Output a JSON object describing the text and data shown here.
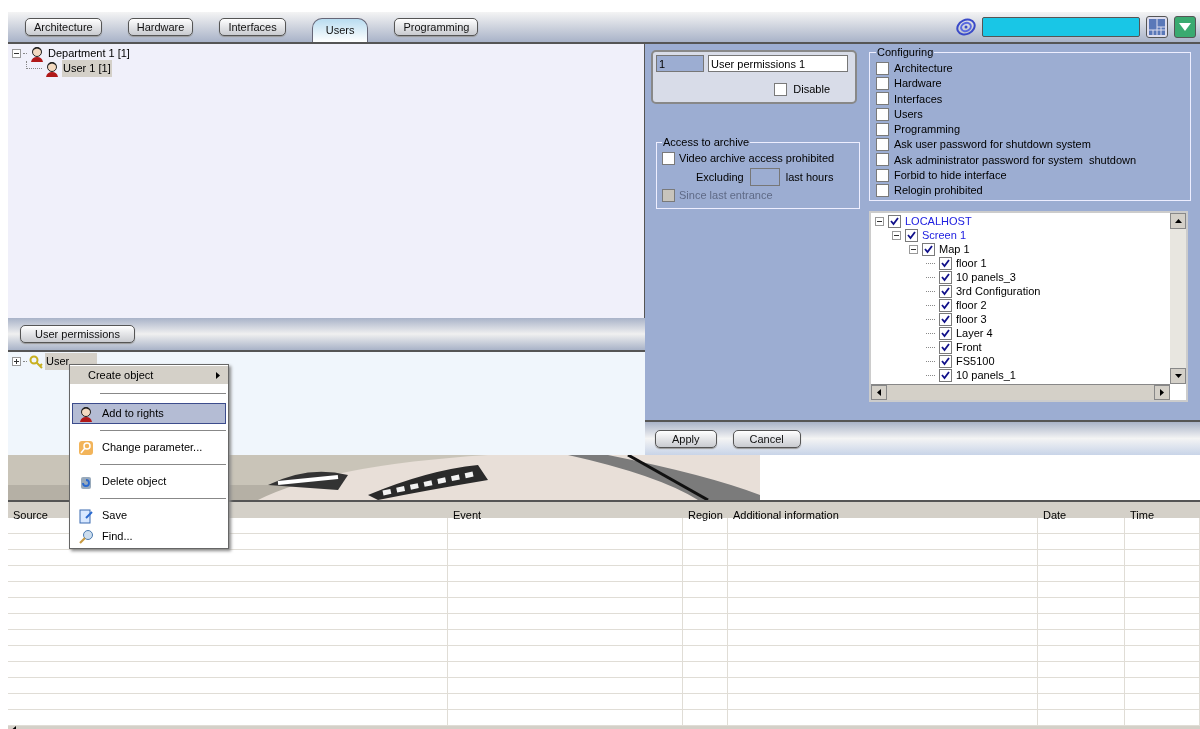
{
  "tabs": [
    {
      "label": "Architecture",
      "selected": false
    },
    {
      "label": "Hardware",
      "selected": false
    },
    {
      "label": "Interfaces",
      "selected": false
    },
    {
      "label": "Users",
      "selected": true
    },
    {
      "label": "Programming",
      "selected": false
    }
  ],
  "users_tree": [
    {
      "label": "Department 1 [1]",
      "expanded": true,
      "selected": false,
      "children": [
        {
          "label": "User 1 [1]",
          "selected": true
        }
      ]
    }
  ],
  "permissions_button": "User permissions",
  "permissions_tree": [
    {
      "label": "User",
      "expanded": false
    }
  ],
  "context_menu": [
    {
      "kind": "submenu",
      "label": "Create object",
      "selected": false
    },
    {
      "kind": "item",
      "label": "Add to rights",
      "selected": true
    },
    {
      "kind": "item",
      "label": "Change parameter...",
      "selected": false
    },
    {
      "kind": "item",
      "label": "Delete object",
      "selected": false
    },
    {
      "kind": "item",
      "label": "Save",
      "selected": false
    },
    {
      "kind": "item",
      "label": "Find...",
      "selected": false
    }
  ],
  "form": {
    "id": "1",
    "name": "User permissions 1",
    "disable": {
      "label": "Disable",
      "checked": false
    }
  },
  "archive": {
    "title": "Access to archive",
    "prohibited": {
      "label": "Video archive access prohibited",
      "checked": false
    },
    "excluding_label": "Excluding",
    "hours_label": "last hours",
    "since": {
      "label": "Since last entrance",
      "checked": false,
      "disabled": true
    }
  },
  "configuring": {
    "title": "Configuring",
    "options": [
      {
        "label": "Architecture",
        "checked": false
      },
      {
        "label": "Hardware",
        "checked": false
      },
      {
        "label": "Interfaces",
        "checked": false
      },
      {
        "label": "Users",
        "checked": false
      },
      {
        "label": "Programming",
        "checked": false
      },
      {
        "label": "Ask user password for shutdown system",
        "checked": false
      },
      {
        "label": "Ask administrator password for system  shutdown",
        "checked": false
      },
      {
        "label": "Forbid to hide interface",
        "checked": false
      },
      {
        "label": "Relogin prohibited",
        "checked": false
      }
    ]
  },
  "objects_tree": [
    {
      "label": "LOCALHOST",
      "checked": true,
      "kind": "link",
      "children": [
        {
          "label": "Screen 1",
          "checked": true,
          "kind": "link",
          "children": [
            {
              "label": "Map 1",
              "checked": true,
              "kind": "plain",
              "children": [
                {
                  "label": "floor 1",
                  "checked": true,
                  "kind": "plain"
                },
                {
                  "label": "10 panels_3",
                  "checked": true,
                  "kind": "plain"
                },
                {
                  "label": "3rd Configuration",
                  "checked": true,
                  "kind": "plain"
                },
                {
                  "label": "floor 2",
                  "checked": true,
                  "kind": "plain"
                },
                {
                  "label": "floor 3",
                  "checked": true,
                  "kind": "plain"
                },
                {
                  "label": "Layer 4",
                  "checked": true,
                  "kind": "plain"
                },
                {
                  "label": "Front",
                  "checked": true,
                  "kind": "plain"
                },
                {
                  "label": "FS5100",
                  "checked": true,
                  "kind": "plain"
                },
                {
                  "label": "10 panels_1",
                  "checked": true,
                  "kind": "plain"
                }
              ]
            }
          ]
        }
      ]
    }
  ],
  "buttons": [
    "Apply",
    "Cancel"
  ],
  "events_table": {
    "columns": [
      "Source",
      "Event",
      "Region",
      "Additional information",
      "Date",
      "Time"
    ]
  }
}
